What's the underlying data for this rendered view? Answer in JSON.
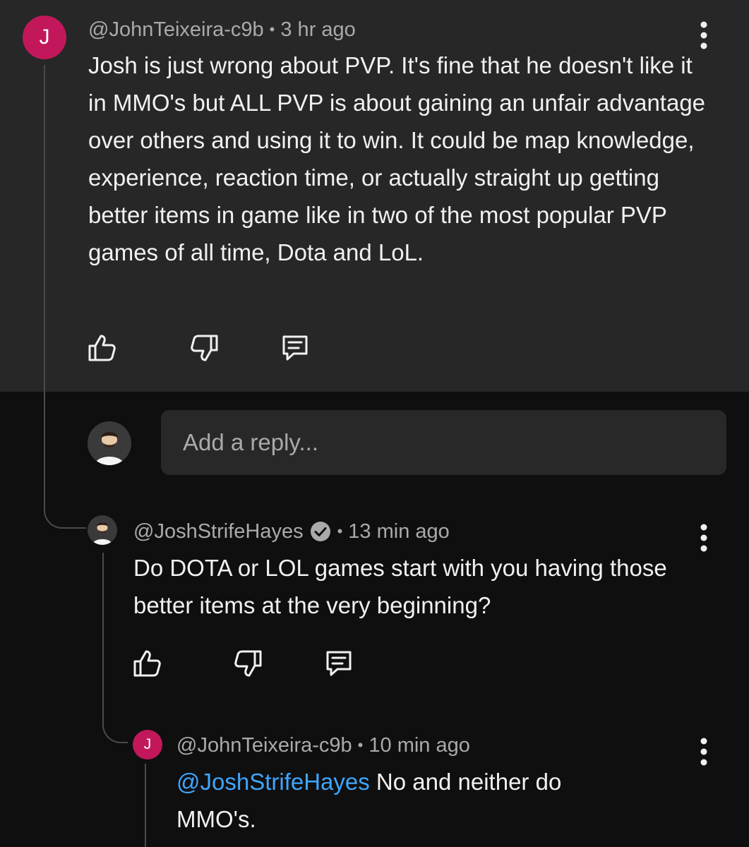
{
  "top_comment": {
    "avatar_letter": "J",
    "author": "@JohnTeixeira-c9b",
    "separator": "•",
    "time": "3 hr ago",
    "text": "Josh is just wrong about PVP. It's fine that he doesn't like it in MMO's but ALL PVP is about gaining an unfair advantage over others and using it to win. It could be map knowledge, experience, reaction time, or actually straight up getting better items in game like in two of the most popular PVP games of all time, Dota and LoL."
  },
  "reply_box": {
    "placeholder": "Add a reply..."
  },
  "reply_1": {
    "author": "@JoshStrifeHayes",
    "verified": true,
    "separator": "•",
    "time": "13 min ago",
    "text": "Do DOTA or LOL games start with you having those better items at the very beginning?"
  },
  "reply_2": {
    "avatar_letter": "J",
    "author": "@JohnTeixeira-c9b",
    "separator": "•",
    "time": "10 min ago",
    "mention": "@JoshStrifeHayes",
    "text": " No and neither do MMO's."
  },
  "icons": {
    "like": "thumbs-up-icon",
    "dislike": "thumbs-down-icon",
    "reply": "comment-reply-icon",
    "more": "more-vertical-icon",
    "verified": "verified-check-icon"
  },
  "colors": {
    "background": "#0f0f0f",
    "highlight_band": "#272727",
    "avatar_accent": "#c2185b",
    "mention": "#3ea6ff",
    "secondary_text": "#aaaaaa",
    "primary_text": "#f1f1f1"
  }
}
